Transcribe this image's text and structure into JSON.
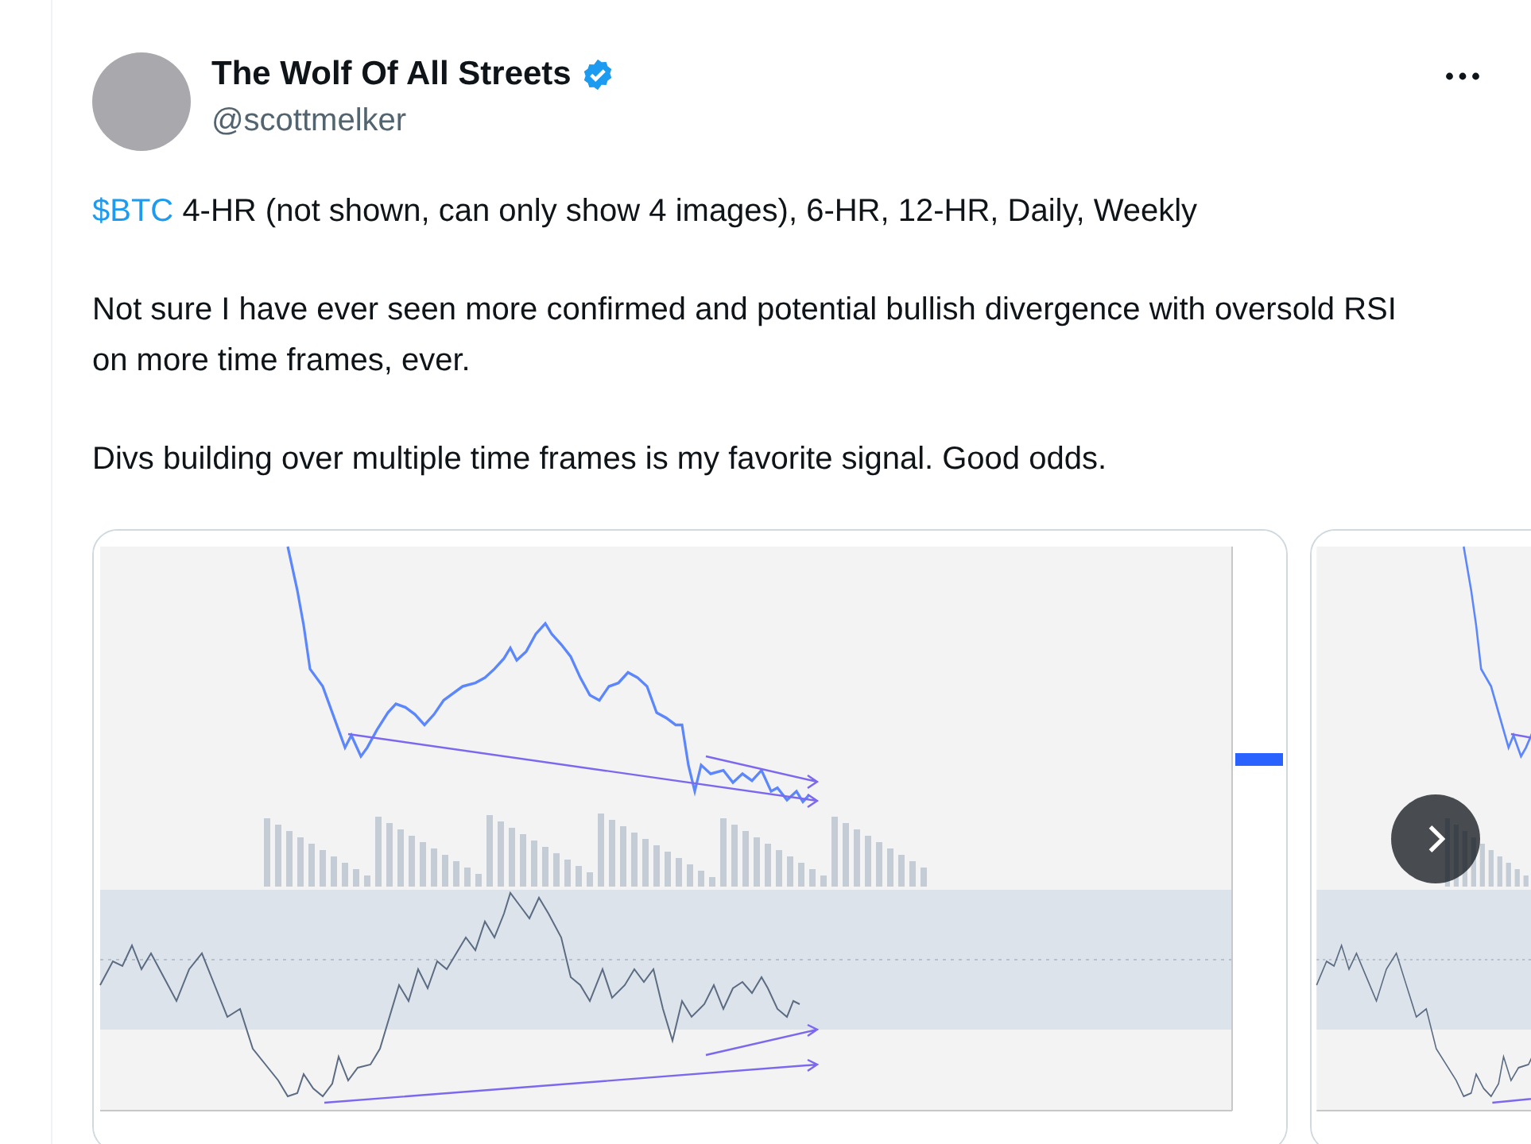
{
  "author": {
    "name": "The Wolf Of All Streets",
    "handle": "@scottmelker",
    "verified": true
  },
  "paragraphs": [
    {
      "cashtag": "$BTC",
      "text": "4-HR (not shown, can only show 4 images), 6-HR, 12-HR, Daily, Weekly"
    },
    {
      "text": "Not sure I have ever seen more confirmed and potential bullish divergence with oversold RSI on more time frames, ever."
    },
    {
      "text": "Divs building over multiple time frames is my favorite signal. Good odds."
    }
  ],
  "media": [
    {
      "kind": "chart"
    },
    {
      "kind": "chart"
    }
  ]
}
